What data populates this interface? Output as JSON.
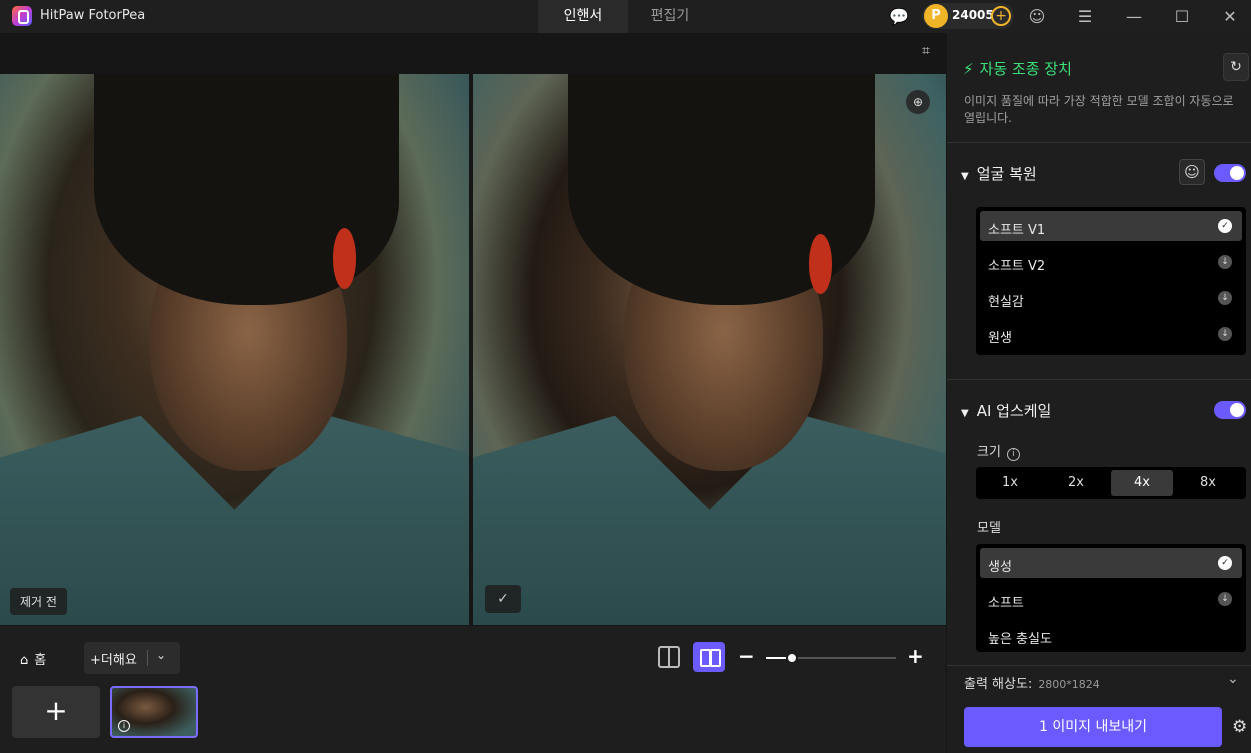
{
  "app": {
    "title": "HitPaw FotorPea"
  },
  "tabs": [
    {
      "label": "인핸서"
    },
    {
      "label": "편집기"
    }
  ],
  "coins": {
    "badge": "P",
    "count": "24005",
    "plus": "+"
  },
  "topbar_icons": {
    "feedback": "💬",
    "profile": "☺",
    "menu": "☰",
    "minimize": "—",
    "maximize": "☐",
    "close": "✕"
  },
  "canvas": {
    "crop_icon": "⌗",
    "before_label": "제거 전",
    "after_check": "✓",
    "zoom_icon": "⊕"
  },
  "bottom": {
    "home_icon": "⌂",
    "home_label": "홈",
    "add_more_label": "+더해요",
    "add_more_chevron": "⌄",
    "zoom_minus": "−",
    "zoom_plus": "+",
    "zoom_level": 0.2,
    "add_tile": "+",
    "thumb_info": "i"
  },
  "panel": {
    "auto_icon": "⚡",
    "auto_title": "자동 조종 장치",
    "refresh_icon": "↻",
    "auto_desc": "이미지 품질에 따라 가장 적합한 모델 조합이 자동으로 열립니다.",
    "face": {
      "caret": "▼",
      "title": "얼굴 복원",
      "face_icon": "☺",
      "enabled": true,
      "items": [
        {
          "label": "소프트 V1",
          "icon": "✓"
        },
        {
          "label": "소프트 V2",
          "icon": "↓"
        },
        {
          "label": "현실감",
          "icon": "↓"
        },
        {
          "label": "원생",
          "icon": "↓"
        }
      ]
    },
    "upscale": {
      "caret": "▼",
      "title": "AI 업스케일",
      "enabled": true,
      "size_label": "크기",
      "info_icon": "i",
      "sizes": [
        "1x",
        "2x",
        "4x",
        "8x"
      ],
      "selected_size": "4x",
      "model_label": "모델",
      "models": [
        {
          "label": "생성",
          "icon": "✓"
        },
        {
          "label": "소프트",
          "icon": "↓"
        },
        {
          "label": "높은 충실도",
          "icon": ""
        }
      ]
    },
    "resolution_label": "출력 해상도:",
    "resolution_value": "2800*1824",
    "resolution_chevron": "⌄",
    "export_label": "1 이미지 내보내기",
    "gear_icon": "⚙"
  }
}
